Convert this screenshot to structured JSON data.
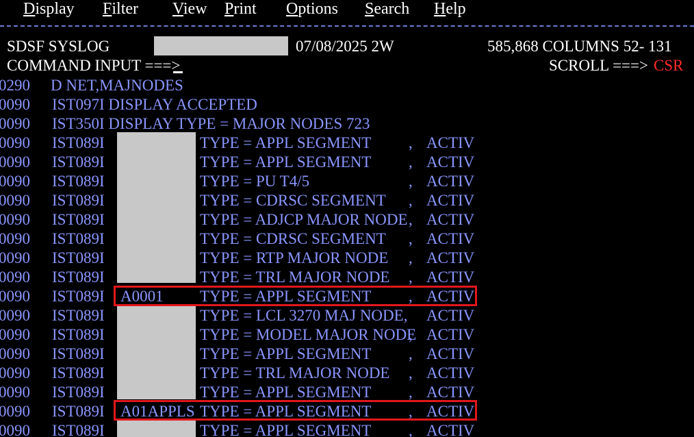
{
  "menu": [
    {
      "accel": "D",
      "rest": "isplay"
    },
    {
      "accel": "F",
      "rest": "ilter"
    },
    {
      "accel": "V",
      "rest": "iew"
    },
    {
      "accel": "P",
      "rest": "rint"
    },
    {
      "accel": "O",
      "rest": "ptions"
    },
    {
      "accel": "S",
      "rest": "earch"
    },
    {
      "accel": "H",
      "rest": "elp"
    }
  ],
  "header": {
    "panel": "SDSF SYSLOG",
    "date": "07/08/2025 2W",
    "line_info": "585,868 COLUMNS 52- 131",
    "command_label": "COMMAND INPUT ===>",
    "scroll_label": "SCROLL ===>",
    "scroll_value": "CSR"
  },
  "log": [
    {
      "sev": "0290",
      "text": "D NET,MAJNODES"
    },
    {
      "sev": "0090",
      "text": "IST097I DISPLAY ACCEPTED"
    },
    {
      "sev": "0090",
      "text": "IST350I DISPLAY TYPE = MAJOR NODES 723"
    }
  ],
  "nodes": [
    {
      "sev": "0090",
      "msg": "IST089I",
      "name": "",
      "type": "TYPE = APPL SEGMENT",
      "comma": ",",
      "status": "ACTIV",
      "redacted": true
    },
    {
      "sev": "0090",
      "msg": "IST089I",
      "name": "",
      "type": "TYPE = APPL SEGMENT",
      "comma": ",",
      "status": "ACTIV",
      "redacted": true
    },
    {
      "sev": "0090",
      "msg": "IST089I",
      "name": "",
      "type": "TYPE = PU T4/5",
      "comma": ",",
      "status": "ACTIV",
      "redacted": true
    },
    {
      "sev": "0090",
      "msg": "IST089I",
      "name": "",
      "type": "TYPE = CDRSC SEGMENT",
      "comma": ",",
      "status": "ACTIV",
      "redacted": true
    },
    {
      "sev": "0090",
      "msg": "IST089I",
      "name": "",
      "type": "TYPE = ADJCP MAJOR NODE",
      "comma": ",",
      "status": "ACTIV",
      "redacted": true
    },
    {
      "sev": "0090",
      "msg": "IST089I",
      "name": "",
      "type": "TYPE = CDRSC SEGMENT",
      "comma": ",",
      "status": "ACTIV",
      "redacted": true
    },
    {
      "sev": "0090",
      "msg": "IST089I",
      "name": "",
      "type": "TYPE = RTP MAJOR NODE",
      "comma": ",",
      "status": "ACTIV",
      "redacted": true
    },
    {
      "sev": "0090",
      "msg": "IST089I",
      "name": "",
      "type": "TYPE = TRL MAJOR NODE",
      "comma": ",",
      "status": "ACTIV",
      "redacted": true
    },
    {
      "sev": "0090",
      "msg": "IST089I",
      "name": "A0001",
      "type": "TYPE = APPL SEGMENT",
      "comma": ",",
      "status": "ACTIV",
      "redacted": false,
      "highlight": true
    },
    {
      "sev": "0090",
      "msg": "IST089I",
      "name": "",
      "type": "TYPE = LCL 3270 MAJ NODE,",
      "comma": "",
      "status": "ACTIV",
      "redacted": true
    },
    {
      "sev": "0090",
      "msg": "IST089I",
      "name": "",
      "type": "TYPE = MODEL MAJOR NODE",
      "comma": ",",
      "status": "ACTIV",
      "redacted": true
    },
    {
      "sev": "0090",
      "msg": "IST089I",
      "name": "",
      "type": "TYPE = APPL SEGMENT",
      "comma": ",",
      "status": "ACTIV",
      "redacted": true
    },
    {
      "sev": "0090",
      "msg": "IST089I",
      "name": "",
      "type": "TYPE = TRL MAJOR NODE",
      "comma": ",",
      "status": "ACTIV",
      "redacted": true
    },
    {
      "sev": "0090",
      "msg": "IST089I",
      "name": "",
      "type": "TYPE = APPL SEGMENT",
      "comma": ",",
      "status": "ACTIV",
      "redacted": true
    },
    {
      "sev": "0090",
      "msg": "IST089I",
      "name": "A01APPLS",
      "type": "TYPE = APPL SEGMENT",
      "comma": ",",
      "status": "ACTIV",
      "redacted": false,
      "highlight": true
    },
    {
      "sev": "0090",
      "msg": "IST089I",
      "name": "",
      "type": "TYPE = APPL SEGMENT",
      "comma": ",",
      "status": "ACTIV",
      "redacted": true
    }
  ],
  "colors": {
    "background": "#000000",
    "log_text": "#8a96ff",
    "header_text": "#ffffff",
    "highlight_box": "#e3171b",
    "scroll_value": "#ff2a2a",
    "redaction": "#c8c8c8"
  }
}
